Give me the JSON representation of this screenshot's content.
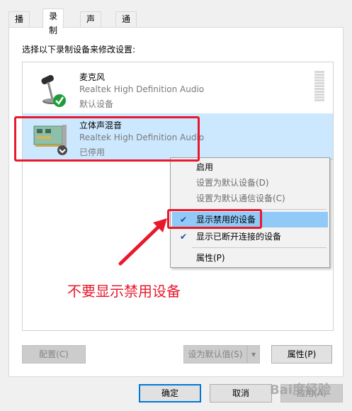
{
  "tabs": [
    {
      "label": "播放"
    },
    {
      "label": "录制"
    },
    {
      "label": "声音"
    },
    {
      "label": "通信"
    }
  ],
  "instruction": "选择以下录制设备来修改设置:",
  "devices": [
    {
      "name": "麦克风",
      "description": "Realtek High Definition Audio",
      "status": "默认设备"
    },
    {
      "name": "立体声混音",
      "description": "Realtek High Definition Audio",
      "status": "已停用"
    }
  ],
  "context_menu": {
    "items": [
      {
        "label": "启用"
      },
      {
        "label": "设置为默认设备(D)"
      },
      {
        "label": "设置为默认通信设备(C)"
      },
      {
        "label": "显示禁用的设备",
        "checked": true
      },
      {
        "label": "显示已断开连接的设备",
        "checked": true
      },
      {
        "label": "属性(P)"
      }
    ],
    "check_mark": "✔"
  },
  "annotation": {
    "text": "不要显示禁用设备",
    "color": "#e8192c"
  },
  "panel_buttons": {
    "configure": "配置(C)",
    "set_default": "设为默认值(S)",
    "dropdown_arrow": "▾",
    "properties": "属性(P)"
  },
  "dialog_buttons": {
    "ok": "确定",
    "cancel": "取消",
    "apply": "应用(A)"
  },
  "watermark": "Bai度经验",
  "colors": {
    "selection": "#cce8ff",
    "menu_highlight": "#91c9f7",
    "accent": "#0078d7"
  }
}
